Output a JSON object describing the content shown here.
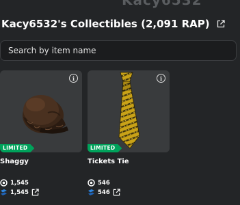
{
  "header": {
    "ghost_username": "Kacy6532",
    "title": "Kacy6532's Collectibles (2,091 RAP)"
  },
  "search": {
    "placeholder": "Search by item name",
    "value": ""
  },
  "items": [
    {
      "name": "Shaggy",
      "badge": "LIMITED",
      "rap": "1,545",
      "value": "1,545"
    },
    {
      "name": "Tickets Tie",
      "badge": "LIMITED",
      "rap": "546",
      "value": "546"
    }
  ],
  "icons": {
    "title_link": "external-link-icon",
    "info": "info-icon",
    "robux": "robux-icon",
    "rolimons": "rolimons-icon",
    "item_link": "external-link-icon"
  },
  "colors": {
    "background": "#232527",
    "card": "#393b3d",
    "limited_badge": "#00a25b",
    "rolimons_blue": "#2f86e0"
  }
}
